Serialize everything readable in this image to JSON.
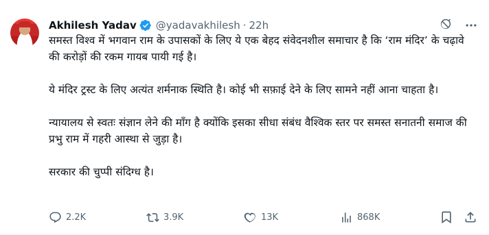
{
  "author": {
    "name": "Akhilesh Yadav",
    "handle": "@yadavakhilesh",
    "separator": "·",
    "time": "22h"
  },
  "tweet": {
    "paragraphs": [
      "समस्त विश्व में भगवान राम के उपासकों के लिए ये एक बेहद संवेदनशील समाचार है कि ‘राम मंदिर’ के चढ़ावे की करोड़ों की रकम गायब पायी गई है।",
      "ये मंदिर ट्रस्ट के लिए अत्यंत शर्मनाक स्थिति है। कोई भी सफ़ाई देने के लिए सामने नहीं आना चाहता है।",
      "न्यायालय से स्वतः संज्ञान लेने की माँग है क्योंकि इसका सीधा संबंध वैश्विक स्तर पर समस्त सनातनी समाज की प्रभु राम में गहरी आस्था से जुड़ा है।",
      "सरकार की चुप्पी संदिग्ध है।"
    ]
  },
  "stats": {
    "replies": "2.2K",
    "reposts": "3.9K",
    "likes": "13K",
    "views": "868K"
  },
  "colors": {
    "text": "#0f1419",
    "secondary": "#536471",
    "verified": "#1d9bf0"
  }
}
